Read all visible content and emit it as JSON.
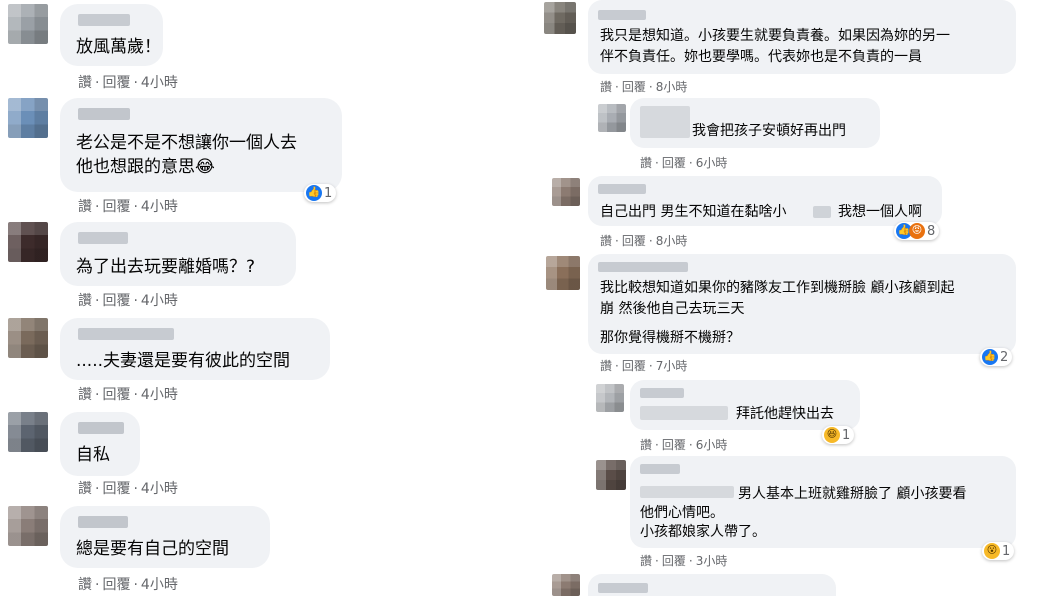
{
  "left_comments": [
    {
      "text": "放風萬歲！",
      "actions": {
        "like": "讚",
        "reply": "回覆",
        "time": "4小時"
      }
    },
    {
      "text_lines": [
        "老公是不是不想讓你一個人去",
        "他也想跟的意思😂"
      ],
      "actions": {
        "like": "讚",
        "reply": "回覆",
        "time": "4小時"
      },
      "reaction": {
        "icon": "like-icon",
        "count": "1"
      }
    },
    {
      "text": "為了出去玩要離婚嗎？?",
      "actions": {
        "like": "讚",
        "reply": "回覆",
        "time": "4小時"
      }
    },
    {
      "text": ".....夫妻還是要有彼此的空間",
      "actions": {
        "like": "讚",
        "reply": "回覆",
        "time": "4小時"
      }
    },
    {
      "text": "自私",
      "actions": {
        "like": "讚",
        "reply": "回覆",
        "time": "4小時"
      }
    },
    {
      "text": "總是要有自己的空間",
      "actions": {
        "like": "讚",
        "reply": "回覆",
        "time": "4小時"
      }
    }
  ],
  "right_comments": [
    {
      "text_lines": [
        "我只是想知道。小孩要生就要負責養。如果因為妳的另一",
        "伴不負責任。妳也要學嗎。代表妳也是不負責的一員"
      ],
      "actions": {
        "like": "讚",
        "reply": "回覆",
        "time": "8小時"
      }
    },
    {
      "text": "我會把孩子安頓好再出門",
      "actions": {
        "like": "讚",
        "reply": "回覆",
        "time": "6小時"
      }
    },
    {
      "text_a": "自己出門 男生不知道在黏啥小",
      "text_b": "我想一個人啊",
      "actions": {
        "like": "讚",
        "reply": "回覆",
        "time": "8小時"
      },
      "reaction": {
        "icons": [
          "like-icon",
          "angry-icon"
        ],
        "count": "8"
      }
    },
    {
      "text_lines": [
        "我比較想知道如果你的豬隊友工作到機掰臉 顧小孩顧到起",
        "崩 然後他自己去玩三天"
      ],
      "text_extra": "那你覺得機掰不機掰？",
      "actions": {
        "like": "讚",
        "reply": "回覆",
        "time": "7小時"
      },
      "reaction": {
        "icon": "like-icon",
        "count": "2"
      }
    },
    {
      "text": "拜託他趕快出去",
      "actions": {
        "like": "讚",
        "reply": "回覆",
        "time": "6小時"
      },
      "reaction": {
        "icon": "haha-icon",
        "count": "1"
      }
    },
    {
      "text_lines": [
        "男人基本上班就雞掰臉了 顧小孩要看",
        "他們心情吧。",
        "小孩都娘家人帶了。"
      ],
      "actions": {
        "like": "讚",
        "reply": "回覆",
        "time": "3小時"
      },
      "reaction": {
        "icon": "wow-icon",
        "count": "1"
      }
    }
  ],
  "glyphs": {
    "like": "👍",
    "haha": "😆",
    "angry": "😡",
    "wow": "😮"
  }
}
